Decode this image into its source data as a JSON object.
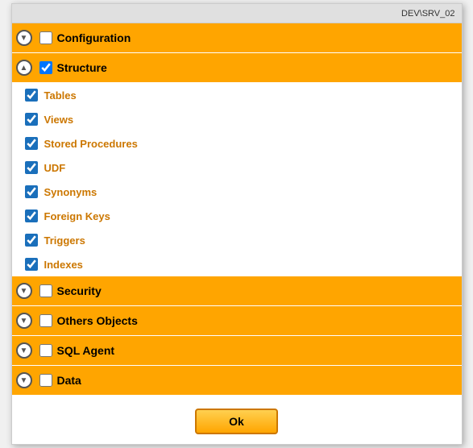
{
  "dialog": {
    "topbar_text": "DEV\\SRV_02",
    "sections": [
      {
        "id": "configuration",
        "label": "Configuration",
        "chevron": "down",
        "checked": false,
        "expanded": false,
        "children": []
      },
      {
        "id": "structure",
        "label": "Structure",
        "chevron": "up",
        "checked": true,
        "expanded": true,
        "children": [
          {
            "id": "tables",
            "label": "Tables",
            "checked": true
          },
          {
            "id": "views",
            "label": "Views",
            "checked": true
          },
          {
            "id": "stored-procedures",
            "label": "Stored Procedures",
            "checked": true
          },
          {
            "id": "udf",
            "label": "UDF",
            "checked": true
          },
          {
            "id": "synonyms",
            "label": "Synonyms",
            "checked": true
          },
          {
            "id": "foreign-keys",
            "label": "Foreign Keys",
            "checked": true
          },
          {
            "id": "triggers",
            "label": "Triggers",
            "checked": true
          },
          {
            "id": "indexes",
            "label": "Indexes",
            "checked": true
          }
        ]
      },
      {
        "id": "security",
        "label": "Security",
        "chevron": "down",
        "checked": false,
        "expanded": false,
        "children": []
      },
      {
        "id": "others-objects",
        "label": "Others Objects",
        "chevron": "down",
        "checked": false,
        "expanded": false,
        "children": []
      },
      {
        "id": "sql-agent",
        "label": "SQL Agent",
        "chevron": "down",
        "checked": false,
        "expanded": false,
        "children": []
      },
      {
        "id": "data",
        "label": "Data",
        "chevron": "down",
        "checked": false,
        "expanded": false,
        "children": []
      }
    ],
    "ok_label": "Ok"
  }
}
